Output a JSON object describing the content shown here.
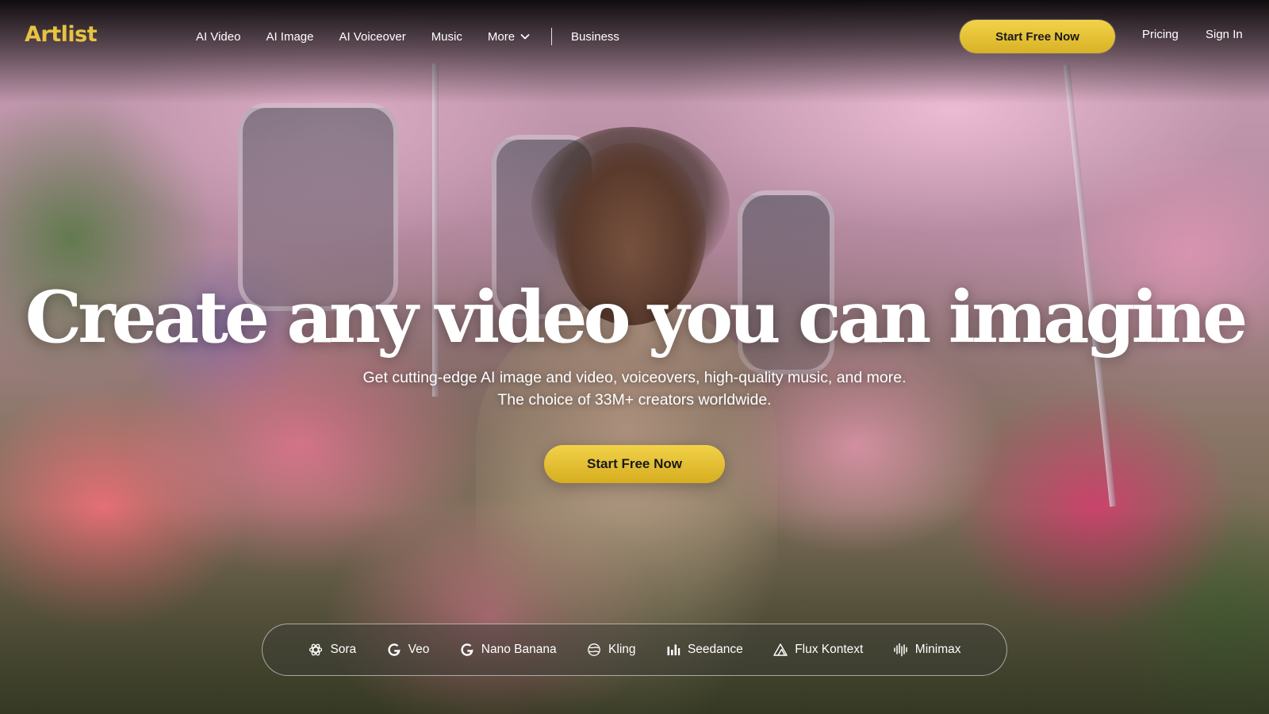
{
  "brand": {
    "logo_text": "Artlist",
    "accent_color": "#e7c341",
    "cta_color": "#f0cf45"
  },
  "nav": {
    "links": [
      {
        "label": "AI Video"
      },
      {
        "label": "AI Image"
      },
      {
        "label": "AI Voiceover"
      },
      {
        "label": "Music"
      },
      {
        "label": "More",
        "icon": "chevron-down-icon"
      },
      {
        "label": "Business"
      }
    ],
    "cta_label": "Start Free Now",
    "pricing_label": "Pricing",
    "signin_label": "Sign In"
  },
  "hero": {
    "title": "Create any video you can imagine",
    "subtitle_line1": "Get cutting-edge AI image and video, voiceovers, high-quality music, and more.",
    "subtitle_line2": "The choice of 33M+ creators worldwide.",
    "cta_label": "Start Free Now"
  },
  "models": [
    {
      "label": "Sora",
      "icon": "openai-icon"
    },
    {
      "label": "Veo",
      "icon": "google-g-icon"
    },
    {
      "label": "Nano Banana",
      "icon": "google-g-icon"
    },
    {
      "label": "Kling",
      "icon": "kling-icon"
    },
    {
      "label": "Seedance",
      "icon": "bar-chart-icon"
    },
    {
      "label": "Flux Kontext",
      "icon": "triangle-icon"
    },
    {
      "label": "Minimax",
      "icon": "waveform-icon"
    }
  ]
}
